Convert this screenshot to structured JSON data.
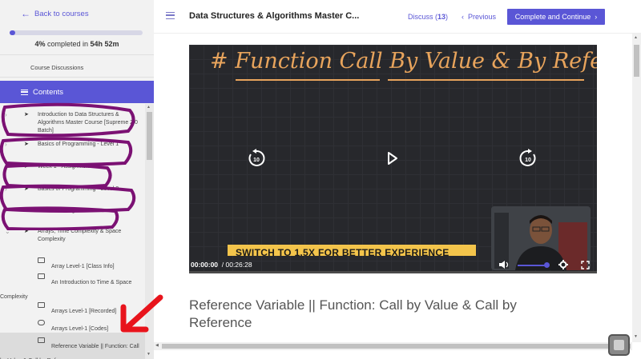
{
  "sidebar": {
    "back_label": "Back to courses",
    "progress_percent": 4,
    "progress_pct_text": "4%",
    "progress_mid_text": " completed in ",
    "progress_time": "54h 52m",
    "course_discussions": "Course Discussions",
    "contents_label": "Contents",
    "sections": [
      {
        "title": "Introduction to Data Structures & Algorithms Master Course [Supreme 2.0 Batch]"
      },
      {
        "title": "Basics of Programming - Level 1"
      },
      {
        "title": "Week 1 - Assignment"
      },
      {
        "title": "Basics of Programming - Level 2"
      },
      {
        "title": "Week 2 - Assignments"
      },
      {
        "title": "Arrays, Time Complexity & Space Complexity"
      }
    ],
    "items": [
      {
        "title": "Array Level-1 [Class Info]",
        "icon": "document-icon"
      },
      {
        "title": "An Introduction to Time & Space Complexity",
        "icon": "video-icon"
      },
      {
        "title": "Arrays Level-1 [Recorded]",
        "icon": "video-icon"
      },
      {
        "title": "Arrays Level-1 [Codes]",
        "icon": "cloud-download-icon"
      },
      {
        "title": "Reference Variable || Function: Call by Value & Call by Reference",
        "icon": "video-icon"
      }
    ]
  },
  "header": {
    "course_title": "Data Structures & Algorithms Master C...",
    "discuss_label": "Discuss (",
    "discuss_count": "13",
    "discuss_close": ")",
    "previous_label": "Previous",
    "complete_label": "Complete and Continue"
  },
  "video": {
    "board_title": "# Function Call By Value & By Reference",
    "banner_text": "SWITCH TO 1.5X FOR BETTER EXPERIENCE",
    "current_time": "00:00:00",
    "duration": "/ 00:26:28",
    "rewind_seconds": "10",
    "forward_seconds": "10",
    "volume_level": 1.0
  },
  "lecture_title": "Reference Variable || Function: Call by Value & Call by Reference",
  "colors": {
    "accent": "#5a56d6",
    "annotation_purple": "#7b1173",
    "annotation_red": "#e8141c",
    "chalk_orange": "#e8a45c",
    "banner_yellow": "#f3c44b"
  }
}
